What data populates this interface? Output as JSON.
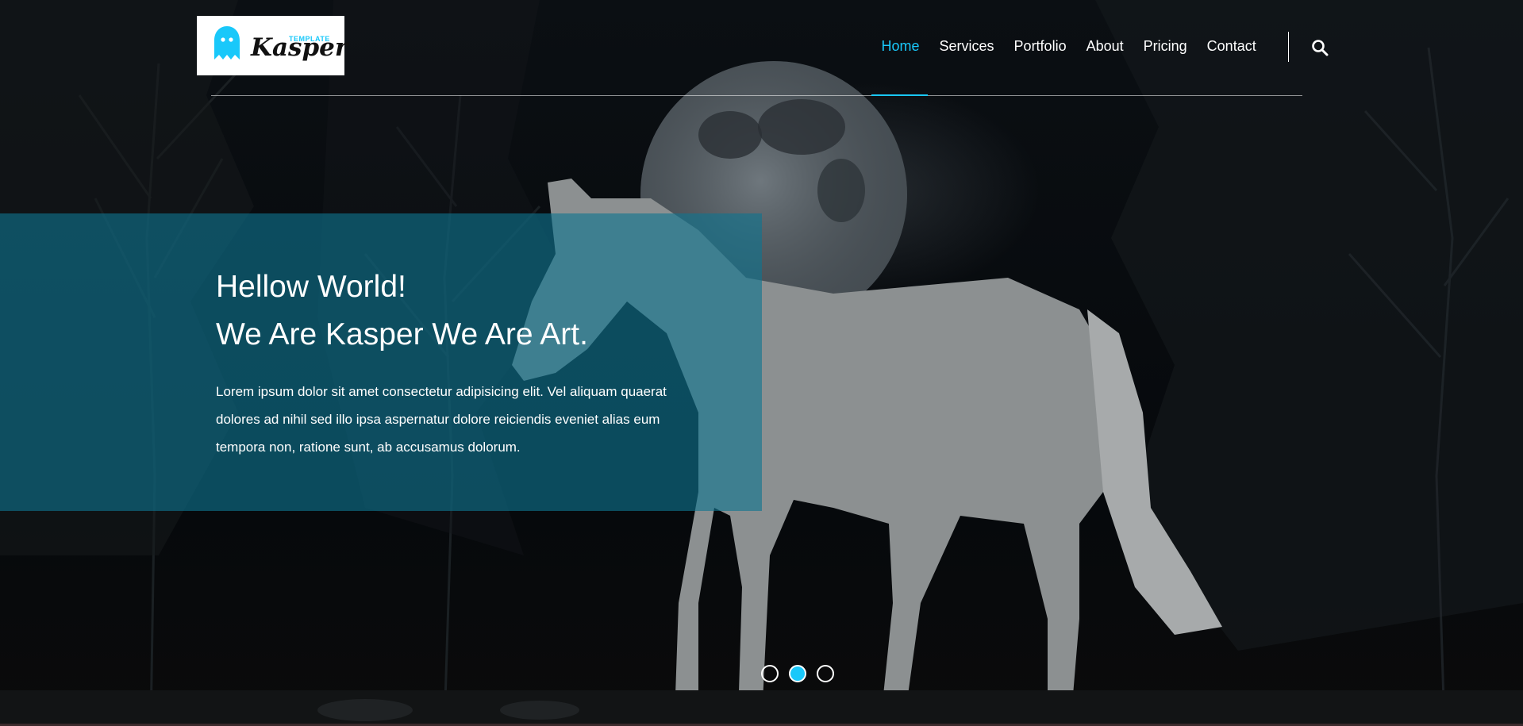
{
  "logo": {
    "small_text": "TEMPLATE",
    "name": "Kasper",
    "icon": "ghost-icon"
  },
  "nav": {
    "items": [
      {
        "label": "Home",
        "active": true
      },
      {
        "label": "Services",
        "active": false
      },
      {
        "label": "Portfolio",
        "active": false
      },
      {
        "label": "About",
        "active": false
      },
      {
        "label": "Pricing",
        "active": false
      },
      {
        "label": "Contact",
        "active": false
      }
    ],
    "search_icon": "search-icon"
  },
  "hero": {
    "line1": "Hellow World!",
    "line2": "We Are Kasper We Are Art.",
    "description": "Lorem ipsum dolor sit amet consectetur adipisicing elit. Vel aliquam quaerat dolores ad nihil sed illo ipsa aspernatur dolore reiciendis eveniet alias eum tempora non, ratione sunt, ab accusamus dolorum."
  },
  "slider": {
    "bullets": 3,
    "active_index": 1
  },
  "colors": {
    "accent": "#19c8fa",
    "panel": "#0f748f",
    "background": "#0a0d10"
  }
}
